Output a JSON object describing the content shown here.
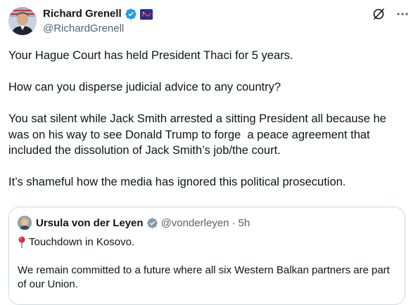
{
  "author": {
    "display_name": "Richard Grenell",
    "handle": "@RichardGrenell",
    "verified_icon": "verified-badge-icon",
    "affiliation_icon": "affiliate-badge-icon"
  },
  "toolbar": {
    "grok_icon": "grok-icon",
    "more_icon": "more-icon"
  },
  "tweet": {
    "text": "Your Hague Court has held President Thaci for 5 years.\n\nHow can you disperse judicial advice to any country?\n\nYou sat silent while Jack Smith arrested a sitting President all because he was on his way to see Donald Trump to forge  a peace agreement that included the dissolution of Jack Smith’s job/the court.\n\nIt’s shameful how the media has ignored this political prosecution."
  },
  "quoted": {
    "display_name": "Ursula von der Leyen",
    "handle": "@vonderleyen",
    "separator": "·",
    "time": "5h",
    "line1": "Touchdown in Kosovo.",
    "line1_icon": "round-pushpin-icon",
    "body": "We remain committed to a future where all six Western Balkan partners are part of our Union."
  },
  "colors": {
    "text": "#0f1419",
    "secondary": "#536471",
    "verified": "#1d9bf0",
    "border": "#cfd9de"
  }
}
